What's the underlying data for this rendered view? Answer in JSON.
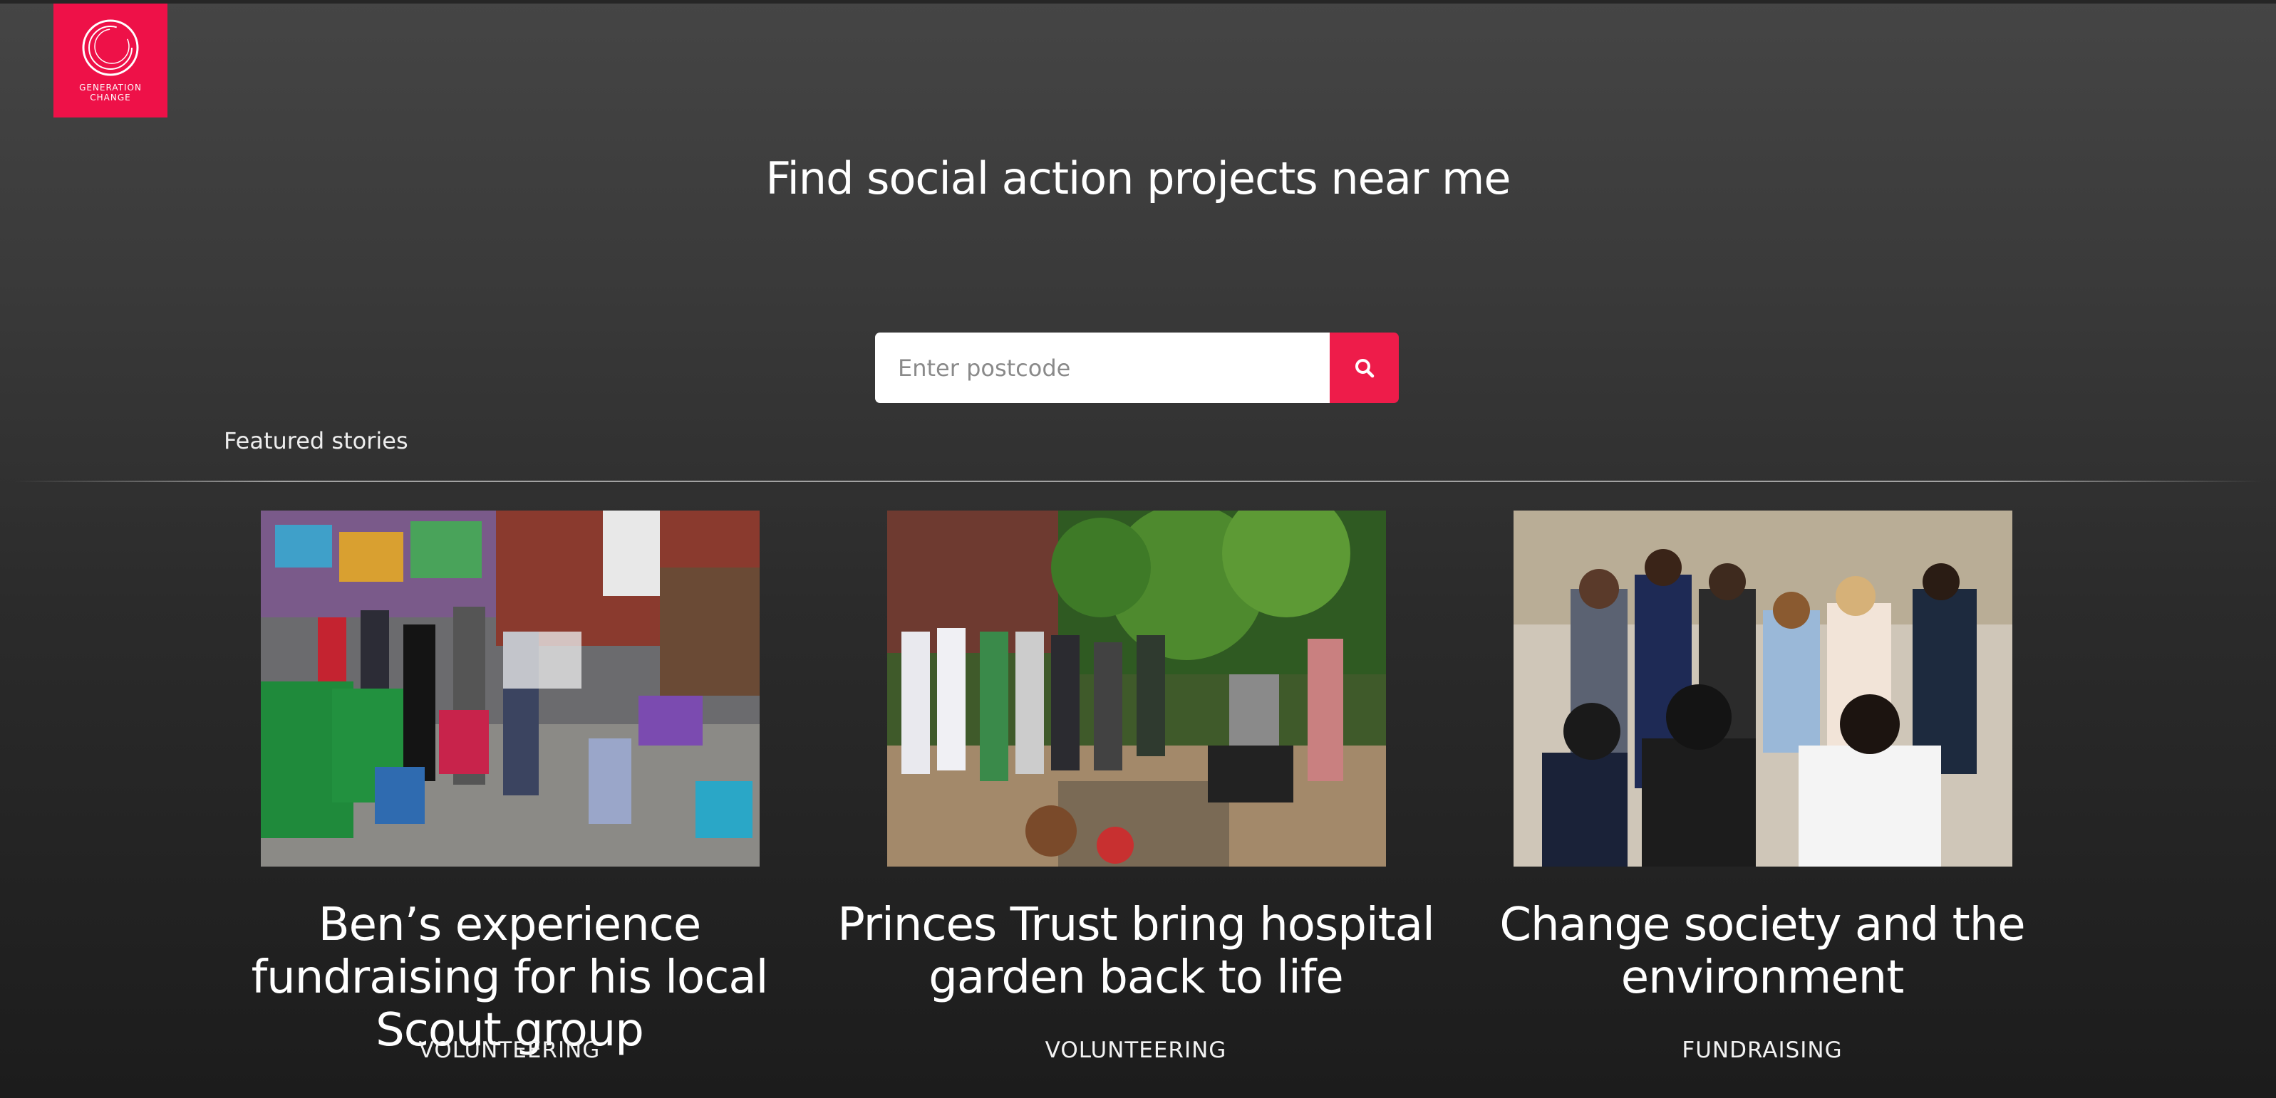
{
  "brand": {
    "logo_text_line1": "GENERATION",
    "logo_text_line2": "CHANGE",
    "color": "#ee1148"
  },
  "hero": {
    "title": "Find social action projects near me"
  },
  "search": {
    "placeholder": "Enter postcode",
    "value": "",
    "button_icon": "search-icon",
    "button_color": "#ee1c4a"
  },
  "featured": {
    "heading": "Featured stories",
    "stories": [
      {
        "title": "Ben’s experience fundraising for his local Scout group",
        "category": "VOLUNTEERING",
        "image": "group-with-donation-bags-photo"
      },
      {
        "title": "Princes Trust bring hospital garden back to life",
        "category": "VOLUNTEERING",
        "image": "hospital-garden-group-photo"
      },
      {
        "title": "Change society and the environment",
        "category": "FUNDRAISING",
        "image": "discussion-circle-photo"
      }
    ]
  }
}
